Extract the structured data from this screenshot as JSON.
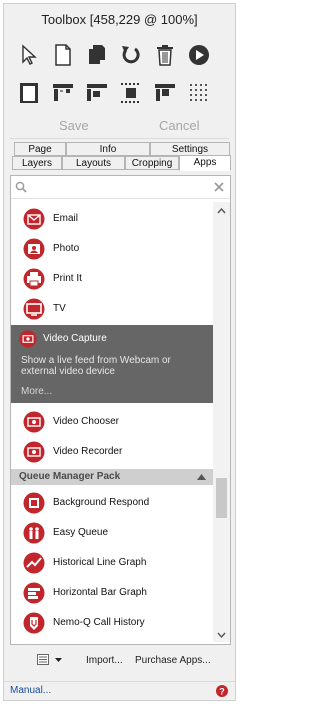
{
  "window": {
    "title": "Toolbox [458,229 @ 100%]"
  },
  "toolbar": {
    "row1": [
      "pointer-tool-icon",
      "new-page-icon",
      "duplicate-page-icon",
      "refresh-icon",
      "trash-icon",
      "play-icon"
    ],
    "row2": [
      "page-layout-icon",
      "align-top-icon",
      "align-left-icon",
      "distribute-icon",
      "align-grid-icon",
      "grid-icon"
    ],
    "save_label": "Save",
    "cancel_label": "Cancel"
  },
  "tabs": {
    "top": [
      "Page",
      "Info",
      "Settings"
    ],
    "bottom": [
      "Layers",
      "Layouts",
      "Cropping",
      "Apps"
    ],
    "active": "Apps"
  },
  "search": {
    "placeholder": ""
  },
  "apps": {
    "items_top": [
      "Email",
      "Photo",
      "Print It",
      "TV"
    ],
    "selected": {
      "label": "Video Capture",
      "description": "Show a live feed from Webcam or external video device",
      "more": "More..."
    },
    "items_mid": [
      "Video Chooser",
      "Video Recorder"
    ],
    "group": "Queue Manager Pack",
    "items_bottom": [
      "Background Respond",
      "Easy Queue",
      "Historical Line Graph",
      "Horizontal Bar Graph",
      "Nemo-Q Call History"
    ]
  },
  "footer": {
    "import_label": "Import...",
    "purchase_label": "Purchase Apps..."
  },
  "status": {
    "manual_label": "Manual..."
  },
  "colors": {
    "accent": "#c0262c",
    "selected_bg": "#666666",
    "link": "#1a4ea0"
  }
}
